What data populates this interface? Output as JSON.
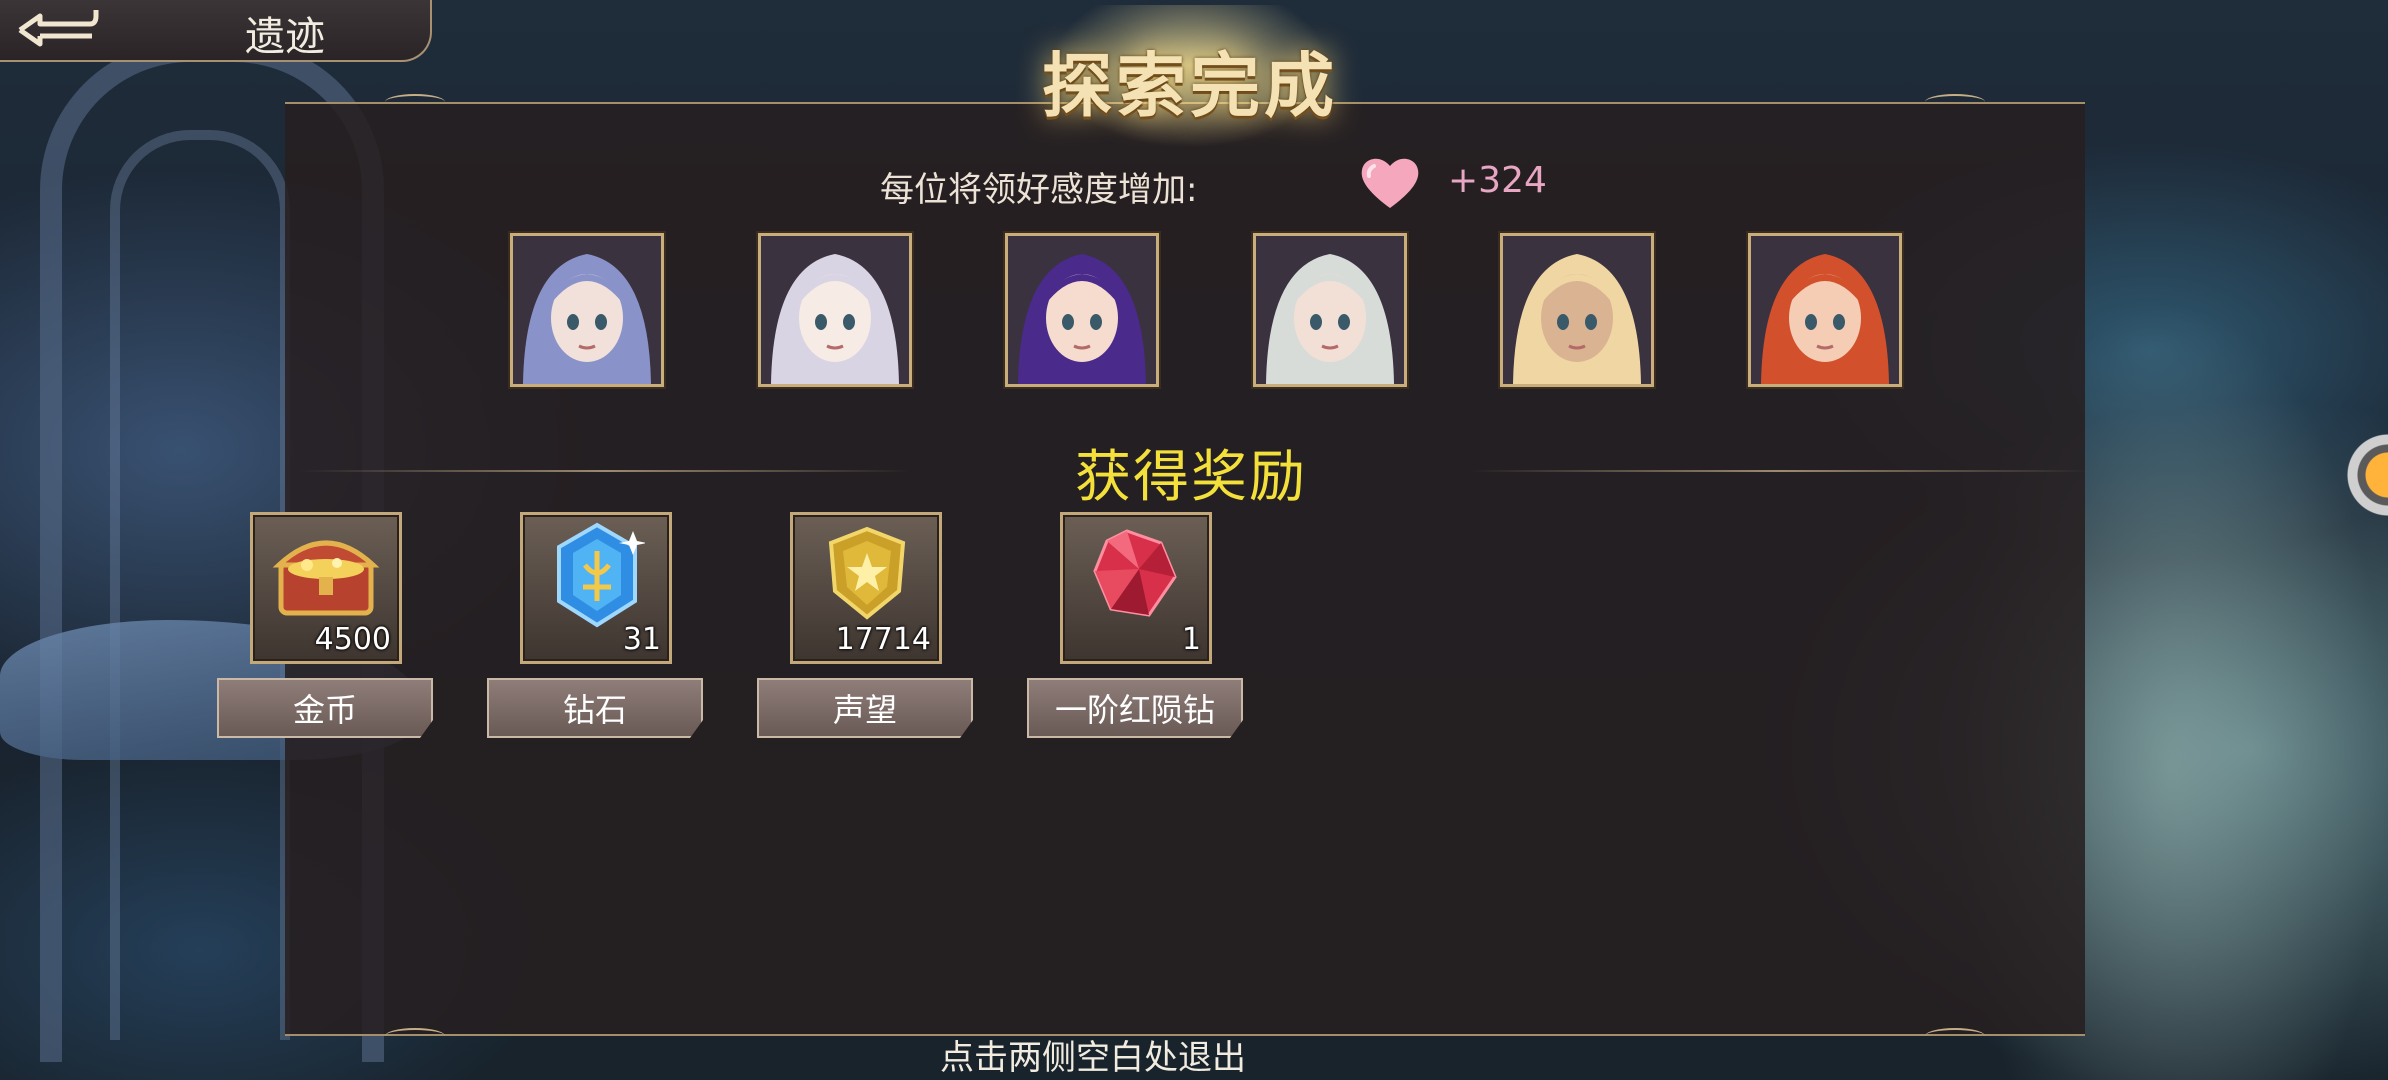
{
  "header": {
    "back_glyph": "⮌",
    "location": "遗迹"
  },
  "title": "探索完成",
  "affection": {
    "label": "每位将领好感度增加:",
    "value": "+324",
    "icon": "heart-icon"
  },
  "portraits": [
    {
      "name": "portrait-1",
      "hair": "#8a93c9",
      "skin": "#f1e1da"
    },
    {
      "name": "portrait-2",
      "hair": "#d9d4e3",
      "skin": "#f7ebe6"
    },
    {
      "name": "portrait-3",
      "hair": "#4a2a8a",
      "skin": "#f6dccf"
    },
    {
      "name": "portrait-4",
      "hair": "#d8dcd9",
      "skin": "#f2e0d6"
    },
    {
      "name": "portrait-5",
      "hair": "#f0d6a2",
      "skin": "#d9b392"
    },
    {
      "name": "portrait-6",
      "hair": "#d2512c",
      "skin": "#f5cdb5"
    }
  ],
  "rewards_title": "获得奖励",
  "rewards": [
    {
      "label": "金币",
      "count": "4500",
      "icon": "treasure-chest-icon"
    },
    {
      "label": "钻石",
      "count": "31",
      "icon": "diamond-crystal-icon"
    },
    {
      "label": "声望",
      "count": "17714",
      "icon": "prestige-badge-icon"
    },
    {
      "label": "一阶红陨钻",
      "count": "1",
      "icon": "red-gem-icon"
    }
  ],
  "exit_hint": "点击两侧空白处退出",
  "colors": {
    "rewards_title": "#f4e03a",
    "affection_value": "#e7a6c2",
    "frame_gold": "#c2a87a"
  }
}
